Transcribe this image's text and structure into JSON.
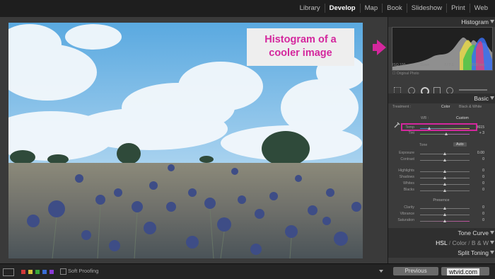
{
  "modules": [
    {
      "label": "Library",
      "active": false
    },
    {
      "label": "Develop",
      "active": true
    },
    {
      "label": "Map",
      "active": false
    },
    {
      "label": "Book",
      "active": false
    },
    {
      "label": "Slideshow",
      "active": false
    },
    {
      "label": "Print",
      "active": false
    },
    {
      "label": "Web",
      "active": false
    }
  ],
  "callout": {
    "line1": "Histogram of a",
    "line2": "cooler image",
    "color": "#d4279d"
  },
  "histogram": {
    "title": "Histogram",
    "iso": "ISO 100",
    "focal": "11mm",
    "aperture": "f / 7.1",
    "shutter": "1/500 sec",
    "original_photo": "Original Photo"
  },
  "basic": {
    "title": "Basic",
    "treatment_label": "Treatment :",
    "color_option": "Color",
    "bw_option": "Black & White",
    "wb_label": "WB :",
    "wb_value": "Custom",
    "temp_label": "Temp",
    "temp_value": "3615",
    "tint_label": "Tint",
    "tint_value": "+ 3",
    "tone_label": "Tone",
    "auto_label": "Auto",
    "exposure_label": "Exposure",
    "exposure_value": "0.00",
    "contrast_label": "Contrast",
    "contrast_value": "0",
    "highlights_label": "Highlights",
    "highlights_value": "0",
    "shadows_label": "Shadows",
    "shadows_value": "0",
    "whites_label": "Whites",
    "whites_value": "0",
    "blacks_label": "Blacks",
    "blacks_value": "0",
    "presence_label": "Presence",
    "clarity_label": "Clarity",
    "clarity_value": "0",
    "vibrance_label": "Vibrance",
    "vibrance_value": "0",
    "saturation_label": "Saturation",
    "saturation_value": "0"
  },
  "panels": {
    "tone_curve": "Tone Curve",
    "hsl": "HSL",
    "color": "Color",
    "bw": "B & W",
    "split_toning": "Split Toning"
  },
  "bottom": {
    "soft_proofing": "Soft Proofing",
    "previous": "Previous",
    "reset": "Reset",
    "watermark": "wtvid.com"
  },
  "swatch_colors": [
    "#d23a3a",
    "#d6c23a",
    "#3aa83a",
    "#3a6ed6",
    "#8a3ad6"
  ]
}
